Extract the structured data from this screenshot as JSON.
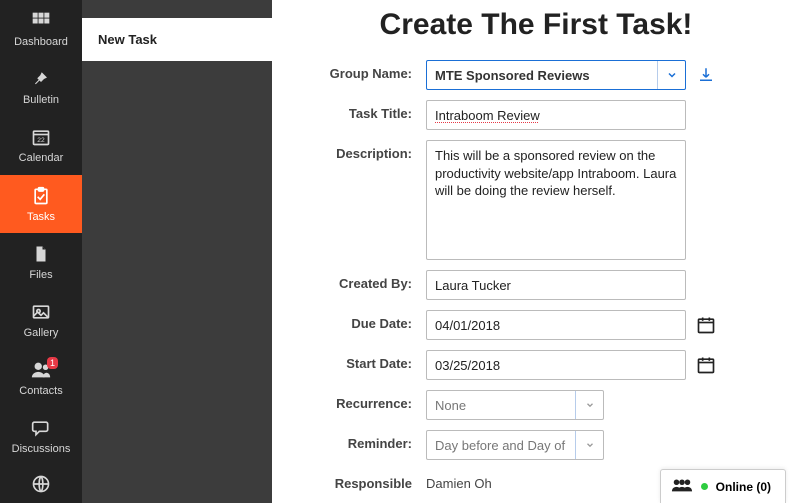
{
  "sidebar": {
    "items": [
      {
        "label": "Dashboard"
      },
      {
        "label": "Bulletin"
      },
      {
        "label": "Calendar"
      },
      {
        "label": "Tasks"
      },
      {
        "label": "Files"
      },
      {
        "label": "Gallery"
      },
      {
        "label": "Contacts",
        "badge": "1"
      },
      {
        "label": "Discussions"
      },
      {
        "label": ""
      }
    ]
  },
  "secondary": {
    "new_task_label": "New Task"
  },
  "form": {
    "title": "Create The First Task!",
    "labels": {
      "group": "Group Name:",
      "task_title": "Task Title:",
      "description": "Description:",
      "created_by": "Created By:",
      "due_date": "Due Date:",
      "start_date": "Start Date:",
      "recurrence": "Recurrence:",
      "reminder": "Reminder:",
      "responsible": "Responsible"
    },
    "values": {
      "group": "MTE Sponsored Reviews",
      "task_title": "Intraboom Review",
      "description": "This will be a sponsored review on the productivity website/app Intraboom. Laura will be doing the review herself.",
      "created_by": "Laura Tucker",
      "due_date": "04/01/2018",
      "start_date": "03/25/2018",
      "recurrence": "None",
      "reminder": "Day before and Day of",
      "responsible": "Damien Oh"
    }
  },
  "status_bar": {
    "online_label": "Online (0)"
  }
}
